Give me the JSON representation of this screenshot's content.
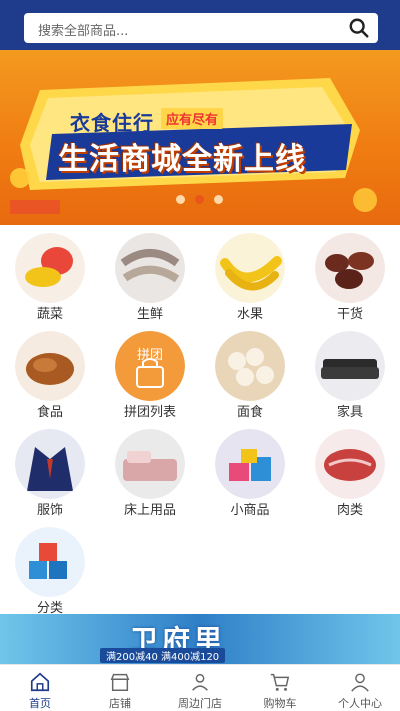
{
  "search": {
    "placeholder": "搜索全部商品..."
  },
  "banner": {
    "small_text": "衣食住行",
    "badge_text": "应有尽有",
    "main_text": "生活商城全新上线",
    "slide_count": 3,
    "active_slide": 2
  },
  "categories": [
    {
      "label": "蔬菜",
      "icon": "vegetables-icon",
      "color": "#e8473a"
    },
    {
      "label": "生鲜",
      "icon": "shrimp-icon",
      "color": "#9a8a82"
    },
    {
      "label": "水果",
      "icon": "banana-icon",
      "color": "#f2c41a"
    },
    {
      "label": "干货",
      "icon": "dates-icon",
      "color": "#6b2a1e"
    },
    {
      "label": "食品",
      "icon": "roast-chicken-icon",
      "color": "#a85a22"
    },
    {
      "label": "拼团列表",
      "icon": "group-buy-icon",
      "color": "#f39a3a",
      "badge": "拼团"
    },
    {
      "label": "面食",
      "icon": "steamed-buns-icon",
      "color": "#f3e3c8"
    },
    {
      "label": "家具",
      "icon": "sofa-icon",
      "color": "#2b2b2b"
    },
    {
      "label": "服饰",
      "icon": "suit-icon",
      "color": "#1f2d6a"
    },
    {
      "label": "床上用品",
      "icon": "bedding-icon",
      "color": "#d9a7a7"
    },
    {
      "label": "小商品",
      "icon": "gift-boxes-icon",
      "color": "#e84a7a"
    },
    {
      "label": "肉类",
      "icon": "meat-icon",
      "color": "#c9413f"
    },
    {
      "label": "分类",
      "icon": "cubes-icon",
      "color": "#2f8fd6"
    }
  ],
  "ad": {
    "title": "卫府里",
    "subtitle": "满200减40 满400减120"
  },
  "tabs": [
    {
      "label": "首页",
      "icon": "home-icon",
      "active": true
    },
    {
      "label": "店铺",
      "icon": "shop-icon",
      "active": false
    },
    {
      "label": "周边门店",
      "icon": "user-pin-icon",
      "active": false
    },
    {
      "label": "购物车",
      "icon": "cart-icon",
      "active": false
    },
    {
      "label": "个人中心",
      "icon": "person-icon",
      "active": false
    }
  ],
  "colors": {
    "brand": "#1f3c8c",
    "banner": "#f07d12",
    "active_dot": "#e9551b"
  }
}
